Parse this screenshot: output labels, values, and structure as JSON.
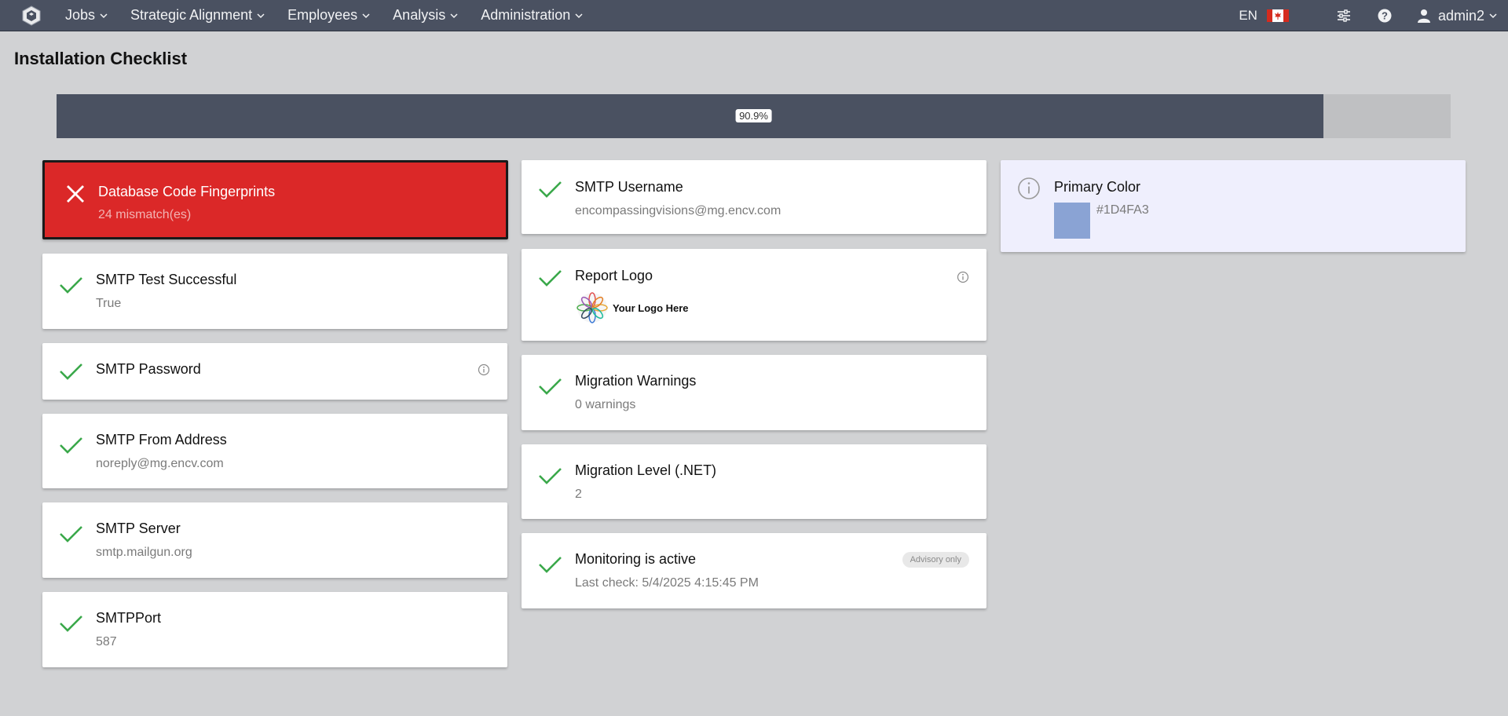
{
  "nav": {
    "items": [
      {
        "label": "Jobs"
      },
      {
        "label": "Strategic Alignment"
      },
      {
        "label": "Employees"
      },
      {
        "label": "Analysis"
      },
      {
        "label": "Administration"
      }
    ],
    "language": "EN",
    "user": "admin2"
  },
  "page": {
    "title": "Installation Checklist",
    "progress_percent": 90.9,
    "progress_label": "90.9%"
  },
  "colors": {
    "nav_bg": "#4a5161",
    "error": "#db2828",
    "success": "#3aa84a",
    "primary_swatch": "#8aa3d4"
  },
  "cards": {
    "db_fingerprints": {
      "title": "Database Code Fingerprints",
      "sub": "24 mismatch(es)",
      "status": "error"
    },
    "smtp_test": {
      "title": "SMTP Test Successful",
      "sub": "True",
      "status": "ok"
    },
    "smtp_password": {
      "title": "SMTP Password",
      "status": "ok"
    },
    "smtp_from": {
      "title": "SMTP From Address",
      "sub": "noreply@mg.encv.com",
      "status": "ok"
    },
    "smtp_server": {
      "title": "SMTP Server",
      "sub": "smtp.mailgun.org",
      "status": "ok"
    },
    "smtp_port": {
      "title": "SMTPPort",
      "sub": "587",
      "status": "ok"
    },
    "smtp_username": {
      "title": "SMTP Username",
      "sub": "encompassingvisions@mg.encv.com",
      "status": "ok"
    },
    "report_logo": {
      "title": "Report Logo",
      "logo_text": "Your Logo Here",
      "status": "ok"
    },
    "migration_warnings": {
      "title": "Migration Warnings",
      "sub": "0 warnings",
      "status": "ok"
    },
    "migration_level": {
      "title": "Migration Level (.NET)",
      "sub": "2",
      "status": "ok"
    },
    "monitoring": {
      "title": "Monitoring is active",
      "sub": "Last check: 5/4/2025 4:15:45 PM",
      "badge": "Advisory only",
      "status": "ok"
    },
    "primary_color": {
      "title": "Primary Color",
      "value": "#1D4FA3",
      "status": "info"
    }
  }
}
